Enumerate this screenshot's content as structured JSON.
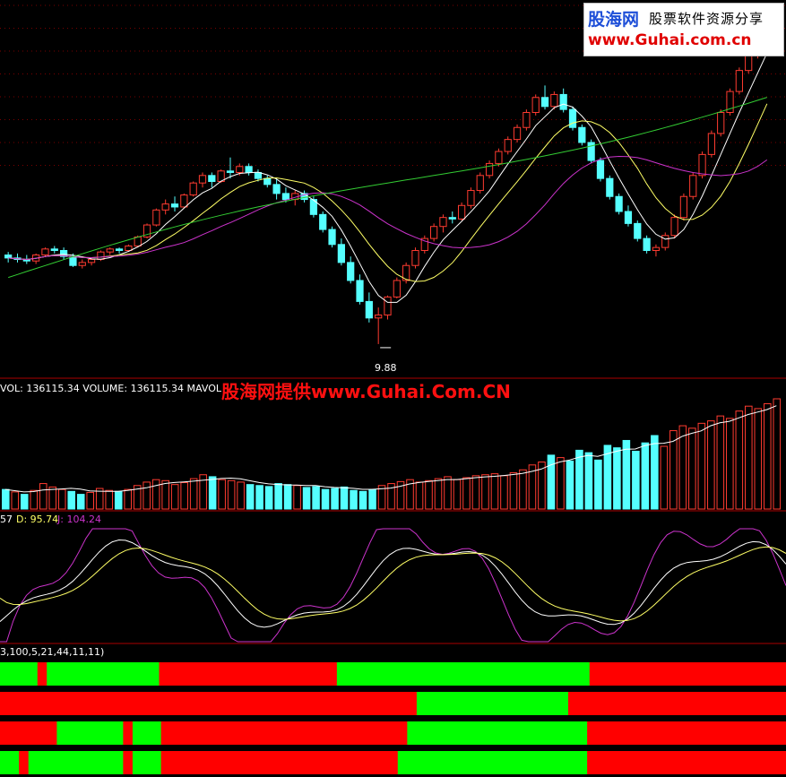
{
  "watermark": {
    "brand": "股海网",
    "slogan": "股票软件资源分享",
    "url": "www.Guhai.com.cn"
  },
  "overlay_text": "股海网提供www.Guhai.Com.CN",
  "colors": {
    "background": "#000000",
    "up": "#ff3b30",
    "down": "#55ffff",
    "ma5": "#ffffff",
    "ma10": "#ffff66",
    "ma20": "#cc33cc",
    "ma60": "#33cc33",
    "panel_border": "#aa0000",
    "bar_red": "#ff0000",
    "bar_green": "#00ff00"
  },
  "chart_data": [
    {
      "type": "candlestick",
      "panel": "price",
      "low_label": "9.88",
      "ohlc": [
        [
          12.85,
          12.95,
          12.6,
          12.75
        ],
        [
          12.75,
          12.9,
          12.6,
          12.7
        ],
        [
          12.7,
          12.85,
          12.55,
          12.65
        ],
        [
          12.65,
          12.9,
          12.55,
          12.85
        ],
        [
          12.85,
          13.1,
          12.8,
          13.05
        ],
        [
          13.05,
          13.15,
          12.9,
          13.0
        ],
        [
          13.0,
          13.1,
          12.7,
          12.8
        ],
        [
          12.8,
          12.9,
          12.45,
          12.5
        ],
        [
          12.5,
          12.7,
          12.4,
          12.6
        ],
        [
          12.6,
          12.75,
          12.5,
          12.7
        ],
        [
          12.7,
          13.0,
          12.65,
          12.95
        ],
        [
          12.95,
          13.1,
          12.85,
          13.05
        ],
        [
          13.05,
          13.1,
          12.9,
          13.0
        ],
        [
          13.0,
          13.2,
          12.95,
          13.15
        ],
        [
          13.15,
          13.5,
          13.1,
          13.45
        ],
        [
          13.45,
          13.9,
          13.4,
          13.85
        ],
        [
          13.85,
          14.4,
          13.8,
          14.35
        ],
        [
          14.35,
          14.7,
          14.2,
          14.55
        ],
        [
          14.55,
          14.8,
          14.3,
          14.45
        ],
        [
          14.45,
          14.9,
          14.4,
          14.85
        ],
        [
          14.85,
          15.3,
          14.8,
          15.25
        ],
        [
          15.25,
          15.6,
          15.1,
          15.5
        ],
        [
          15.5,
          15.6,
          15.1,
          15.3
        ],
        [
          15.3,
          15.7,
          15.25,
          15.65
        ],
        [
          15.65,
          16.1,
          15.4,
          15.6
        ],
        [
          15.6,
          15.9,
          15.5,
          15.8
        ],
        [
          15.8,
          15.9,
          15.5,
          15.6
        ],
        [
          15.6,
          15.7,
          15.3,
          15.4
        ],
        [
          15.4,
          15.5,
          15.1,
          15.2
        ],
        [
          15.2,
          15.4,
          14.7,
          14.9
        ],
        [
          14.9,
          15.1,
          14.6,
          14.7
        ],
        [
          14.7,
          15.0,
          14.5,
          14.9
        ],
        [
          14.9,
          15.0,
          14.6,
          14.7
        ],
        [
          14.7,
          14.8,
          14.1,
          14.2
        ],
        [
          14.2,
          14.3,
          13.6,
          13.7
        ],
        [
          13.7,
          13.8,
          13.1,
          13.2
        ],
        [
          13.2,
          13.4,
          12.5,
          12.6
        ],
        [
          12.6,
          12.8,
          11.9,
          12.0
        ],
        [
          12.0,
          12.2,
          11.2,
          11.3
        ],
        [
          11.3,
          11.6,
          10.6,
          10.75
        ],
        [
          10.75,
          11.1,
          9.88,
          10.85
        ],
        [
          10.85,
          11.5,
          10.7,
          11.45
        ],
        [
          11.45,
          12.1,
          11.4,
          12.0
        ],
        [
          12.0,
          12.6,
          11.9,
          12.5
        ],
        [
          12.5,
          13.1,
          12.4,
          13.0
        ],
        [
          13.0,
          13.5,
          12.9,
          13.4
        ],
        [
          13.4,
          13.9,
          13.3,
          13.8
        ],
        [
          13.8,
          14.2,
          13.6,
          14.1
        ],
        [
          14.1,
          14.3,
          13.9,
          14.05
        ],
        [
          14.05,
          14.6,
          14.0,
          14.5
        ],
        [
          14.5,
          15.1,
          14.4,
          15.0
        ],
        [
          15.0,
          15.6,
          14.9,
          15.5
        ],
        [
          15.5,
          16.0,
          15.4,
          15.9
        ],
        [
          15.9,
          16.4,
          15.8,
          16.3
        ],
        [
          16.3,
          16.8,
          16.2,
          16.7
        ],
        [
          16.7,
          17.2,
          16.6,
          17.1
        ],
        [
          17.1,
          17.7,
          17.0,
          17.6
        ],
        [
          17.6,
          18.2,
          17.5,
          18.1
        ],
        [
          18.1,
          18.5,
          17.7,
          17.8
        ],
        [
          17.8,
          18.3,
          17.7,
          18.2
        ],
        [
          18.2,
          18.4,
          17.6,
          17.7
        ],
        [
          17.7,
          17.8,
          17.0,
          17.1
        ],
        [
          17.1,
          17.2,
          16.5,
          16.6
        ],
        [
          16.6,
          16.7,
          15.9,
          16.0
        ],
        [
          16.0,
          16.1,
          15.3,
          15.4
        ],
        [
          15.4,
          15.5,
          14.7,
          14.8
        ],
        [
          14.8,
          14.9,
          14.2,
          14.3
        ],
        [
          14.3,
          14.5,
          13.8,
          13.9
        ],
        [
          13.9,
          14.0,
          13.3,
          13.4
        ],
        [
          13.4,
          13.5,
          12.9,
          13.0
        ],
        [
          13.0,
          13.2,
          12.8,
          13.1
        ],
        [
          13.1,
          13.6,
          13.0,
          13.5
        ],
        [
          13.5,
          14.2,
          13.4,
          14.1
        ],
        [
          14.1,
          14.9,
          14.0,
          14.8
        ],
        [
          14.8,
          15.6,
          14.7,
          15.5
        ],
        [
          15.5,
          16.3,
          15.4,
          16.2
        ],
        [
          16.2,
          17.0,
          16.1,
          16.9
        ],
        [
          16.9,
          17.7,
          16.8,
          17.6
        ],
        [
          17.6,
          18.4,
          17.5,
          18.3
        ],
        [
          18.3,
          19.1,
          18.2,
          19.0
        ],
        [
          19.0,
          19.6,
          18.9,
          19.5
        ],
        [
          19.5,
          20.3,
          19.4,
          20.2
        ],
        [
          20.2,
          21.0,
          20.1,
          20.9
        ]
      ],
      "ma_periods": [
        5,
        10,
        20,
        60
      ]
    },
    {
      "type": "bar",
      "panel": "volume",
      "header": "VOL: 136115.34  VOLUME: 136115.34  MAVOL",
      "values": [
        40,
        35,
        30,
        38,
        52,
        45,
        40,
        36,
        30,
        34,
        42,
        38,
        36,
        40,
        48,
        55,
        60,
        58,
        50,
        54,
        62,
        70,
        66,
        60,
        58,
        55,
        50,
        48,
        46,
        52,
        50,
        48,
        44,
        46,
        40,
        42,
        45,
        38,
        36,
        40,
        48,
        52,
        56,
        60,
        55,
        58,
        62,
        66,
        60,
        64,
        68,
        70,
        72,
        68,
        74,
        80,
        90,
        96,
        110,
        105,
        98,
        120,
        115,
        100,
        130,
        125,
        140,
        118,
        135,
        150,
        128,
        160,
        170,
        165,
        175,
        180,
        190,
        185,
        200,
        210,
        205,
        215,
        225
      ],
      "down_days": [
        0,
        2,
        7,
        8,
        12,
        22,
        26,
        27,
        28,
        29,
        30,
        32,
        33,
        34,
        35,
        36,
        37,
        38,
        39,
        58,
        60,
        61,
        62,
        63,
        64,
        65,
        66,
        67,
        68,
        69
      ]
    },
    {
      "type": "line",
      "panel": "kdj",
      "header_left": "57",
      "series": [
        {
          "name": "D",
          "label": "D: 95.74",
          "color": "#ffff66"
        },
        {
          "name": "J",
          "label": "J: 104.24",
          "color": "#cc33cc"
        }
      ]
    },
    {
      "type": "strip",
      "panel": "signal",
      "header": "3,100,5,21,44,11,11)",
      "rows": [
        [
          "g",
          "g",
          "g",
          "g",
          "r",
          "g",
          "g",
          "g",
          "g",
          "g",
          "g",
          "g",
          "g",
          "g",
          "g",
          "g",
          "g",
          "r",
          "r",
          "r",
          "r",
          "r",
          "r",
          "r",
          "r",
          "r",
          "r",
          "r",
          "r",
          "r",
          "r",
          "r",
          "r",
          "r",
          "r",
          "r",
          "g",
          "g",
          "g",
          "g",
          "g",
          "g",
          "g",
          "g",
          "g",
          "g",
          "g",
          "g",
          "g",
          "g",
          "g",
          "g",
          "g",
          "g",
          "g",
          "g",
          "g",
          "g",
          "g",
          "g",
          "g",
          "g",
          "g",
          "r",
          "r",
          "r",
          "r",
          "r",
          "r",
          "r",
          "r",
          "r",
          "r",
          "r",
          "r",
          "r",
          "r",
          "r",
          "r",
          "r",
          "r",
          "r",
          "r",
          "r"
        ],
        [
          "r",
          "r",
          "r",
          "r",
          "r",
          "r",
          "r",
          "r",
          "r",
          "r",
          "r",
          "r",
          "r",
          "r",
          "r",
          "r",
          "r",
          "r",
          "r",
          "r",
          "r",
          "r",
          "r",
          "r",
          "r",
          "r",
          "r",
          "r",
          "r",
          "r",
          "r",
          "r",
          "r",
          "r",
          "r",
          "r",
          "r",
          "r",
          "r",
          "r",
          "r",
          "r",
          "r",
          "r",
          "g",
          "g",
          "g",
          "g",
          "g",
          "g",
          "g",
          "g",
          "g",
          "g",
          "g",
          "g",
          "g",
          "g",
          "g",
          "g",
          "r",
          "r",
          "r",
          "r",
          "r",
          "r",
          "r",
          "r",
          "r",
          "r",
          "r",
          "r",
          "r",
          "r",
          "r",
          "r",
          "r",
          "r",
          "r",
          "r",
          "r",
          "r",
          "r"
        ],
        [
          "r",
          "r",
          "r",
          "r",
          "r",
          "r",
          "g",
          "g",
          "g",
          "g",
          "g",
          "g",
          "g",
          "r",
          "g",
          "g",
          "g",
          "r",
          "r",
          "r",
          "r",
          "r",
          "r",
          "r",
          "r",
          "r",
          "r",
          "r",
          "r",
          "r",
          "r",
          "r",
          "r",
          "r",
          "r",
          "r",
          "r",
          "r",
          "r",
          "r",
          "r",
          "r",
          "r",
          "g",
          "g",
          "g",
          "g",
          "g",
          "g",
          "g",
          "g",
          "g",
          "g",
          "g",
          "g",
          "g",
          "g",
          "g",
          "g",
          "g",
          "g",
          "g",
          "r",
          "r",
          "r",
          "r",
          "r",
          "r",
          "r",
          "r",
          "r",
          "r",
          "r",
          "r",
          "r",
          "r",
          "r",
          "r",
          "r",
          "r",
          "r",
          "r",
          "r"
        ],
        [
          "g",
          "g",
          "r",
          "g",
          "g",
          "g",
          "g",
          "g",
          "g",
          "g",
          "g",
          "g",
          "g",
          "r",
          "g",
          "g",
          "g",
          "r",
          "r",
          "r",
          "r",
          "r",
          "r",
          "r",
          "r",
          "r",
          "r",
          "r",
          "r",
          "r",
          "r",
          "r",
          "r",
          "r",
          "r",
          "r",
          "r",
          "r",
          "r",
          "r",
          "r",
          "r",
          "g",
          "g",
          "g",
          "g",
          "g",
          "g",
          "g",
          "g",
          "g",
          "g",
          "g",
          "g",
          "g",
          "g",
          "g",
          "g",
          "g",
          "g",
          "g",
          "g",
          "r",
          "r",
          "r",
          "r",
          "r",
          "r",
          "r",
          "r",
          "r",
          "r",
          "r",
          "r",
          "r",
          "r",
          "r",
          "r",
          "r",
          "r",
          "r",
          "r",
          "r"
        ]
      ]
    }
  ]
}
